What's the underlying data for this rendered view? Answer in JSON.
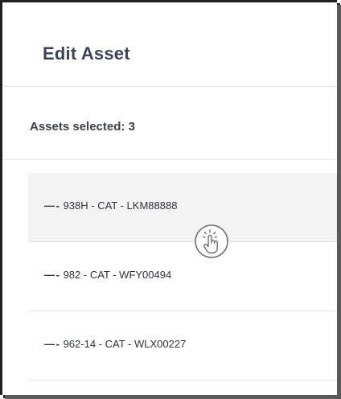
{
  "dialog": {
    "title": "Edit Asset",
    "selected_label": "Assets selected: 3"
  },
  "assets": [
    {
      "label": "938H - CAT - LKM88888",
      "active": true
    },
    {
      "label": "982 - CAT - WFY00494",
      "active": false
    },
    {
      "label": "962-14 - CAT - WLX00227",
      "active": false
    }
  ],
  "row_prefix": "— -",
  "icons": {
    "tap": "tap-gesture-icon"
  },
  "colors": {
    "title": "#3d4458",
    "active_row": "#f3f3f4",
    "divider": "#e3e4e7"
  }
}
